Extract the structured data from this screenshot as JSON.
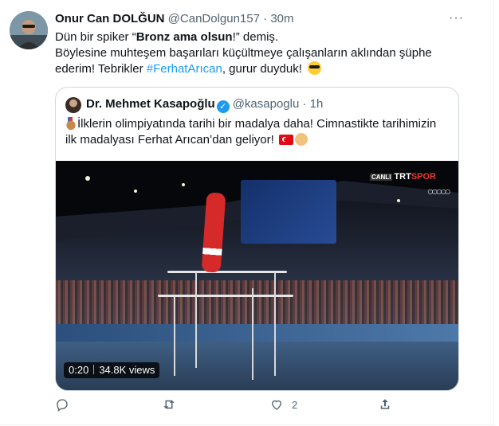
{
  "tweet": {
    "display_name": "Onur Can DOLĞUN",
    "handle": "@CanDolgun157",
    "separator": "·",
    "time": "30m",
    "more_label": "···",
    "text_part1": "Dün bir spiker “",
    "text_bold": "Bronz ama olsun",
    "text_part2": "!” demiş.",
    "line2": "Böylesine muhteşem başarıları küçültmeye çalışanların aklından şüphe",
    "line3_part1": "ederim! Tebrikler ",
    "hashtag": "#FerhatArıcan",
    "line3_part2": ", gurur duyduk!",
    "emoji": "sunglasses-face"
  },
  "quoted": {
    "display_name": "Dr. Mehmet Kasapoğlu",
    "verified_icon": "verified-badge-icon",
    "handle": "@kasapoglu",
    "separator": "·",
    "time": "1h",
    "line1": "İlklerin olimpiyatında tarihi bir madalya daha! Cimnastikte tarihimizin",
    "line2": "ilk madalyası Ferhat Arıcan’dan geliyor!",
    "emojis": [
      "bronze-medal",
      "turkey-flag",
      "clapping-hands"
    ],
    "video": {
      "duration": "0:20",
      "views": "34.8K views",
      "broadcaster_prefix": "CANLI",
      "broadcaster_name_a": "TRT",
      "broadcaster_name_b": "SPOR"
    }
  },
  "actions": {
    "reply_icon": "reply-icon",
    "retweet_icon": "retweet-icon",
    "like_icon": "heart-icon",
    "like_count": "2",
    "share_icon": "share-icon"
  },
  "colors": {
    "link": "#1d9bf0",
    "muted": "#536471",
    "text": "#0f1419",
    "border": "#cfd9de"
  }
}
